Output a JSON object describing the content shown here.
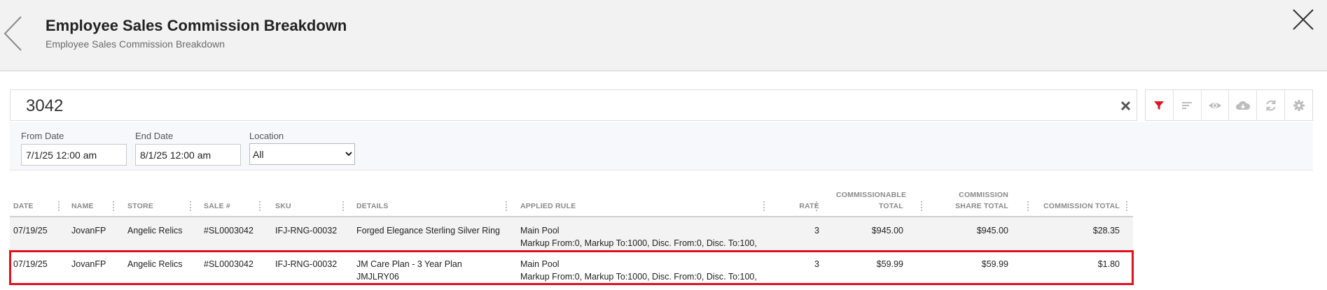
{
  "header": {
    "title": "Employee Sales Commission Breakdown",
    "subtitle": "Employee Sales Commission Breakdown"
  },
  "search": {
    "value": "3042"
  },
  "toolbar": {
    "icons": [
      "filter-icon",
      "sort-icon",
      "eye-icon",
      "cloud-download-icon",
      "refresh-icon",
      "gear-icon"
    ],
    "active_color": "#e0101e"
  },
  "filters": {
    "from_date_label": "From Date",
    "from_date_value": "7/1/25 12:00 am",
    "end_date_label": "End Date",
    "end_date_value": "8/1/25 12:00 am",
    "location_label": "Location",
    "location_value": "All"
  },
  "table": {
    "columns": [
      "DATE",
      "NAME",
      "STORE",
      "SALE #",
      "SKU",
      "DETAILS",
      "APPLIED RULE",
      "RATE",
      "COMMISSIONABLE TOTAL",
      "COMMISSION SHARE TOTAL",
      "COMMISSION TOTAL"
    ],
    "rows": [
      {
        "date": "07/19/25",
        "name": "JovanFP",
        "store": "Angelic Relics",
        "sale": "#SL0003042",
        "sku": "IFJ-RNG-00032",
        "details": "Forged Elegance Sterling Silver Ring",
        "details_sub": "",
        "rule": "Main Pool",
        "rule_sub": "Markup From:0, Markup To:1000, Disc. From:0, Disc. To:100,",
        "rate": "3",
        "commissionable": "$945.00",
        "share": "$945.00",
        "total": "$28.35"
      },
      {
        "date": "07/19/25",
        "name": "JovanFP",
        "store": "Angelic Relics",
        "sale": "#SL0003042",
        "sku": "IFJ-RNG-00032",
        "details": "JM Care Plan - 3 Year Plan",
        "details_sub": "JMJLRY06",
        "rule": "Main Pool",
        "rule_sub": "Markup From:0, Markup To:1000, Disc. From:0, Disc. To:100,",
        "rate": "3",
        "commissionable": "$59.99",
        "share": "$59.99",
        "total": "$1.80"
      }
    ],
    "highlight_color": "#e0101e"
  }
}
